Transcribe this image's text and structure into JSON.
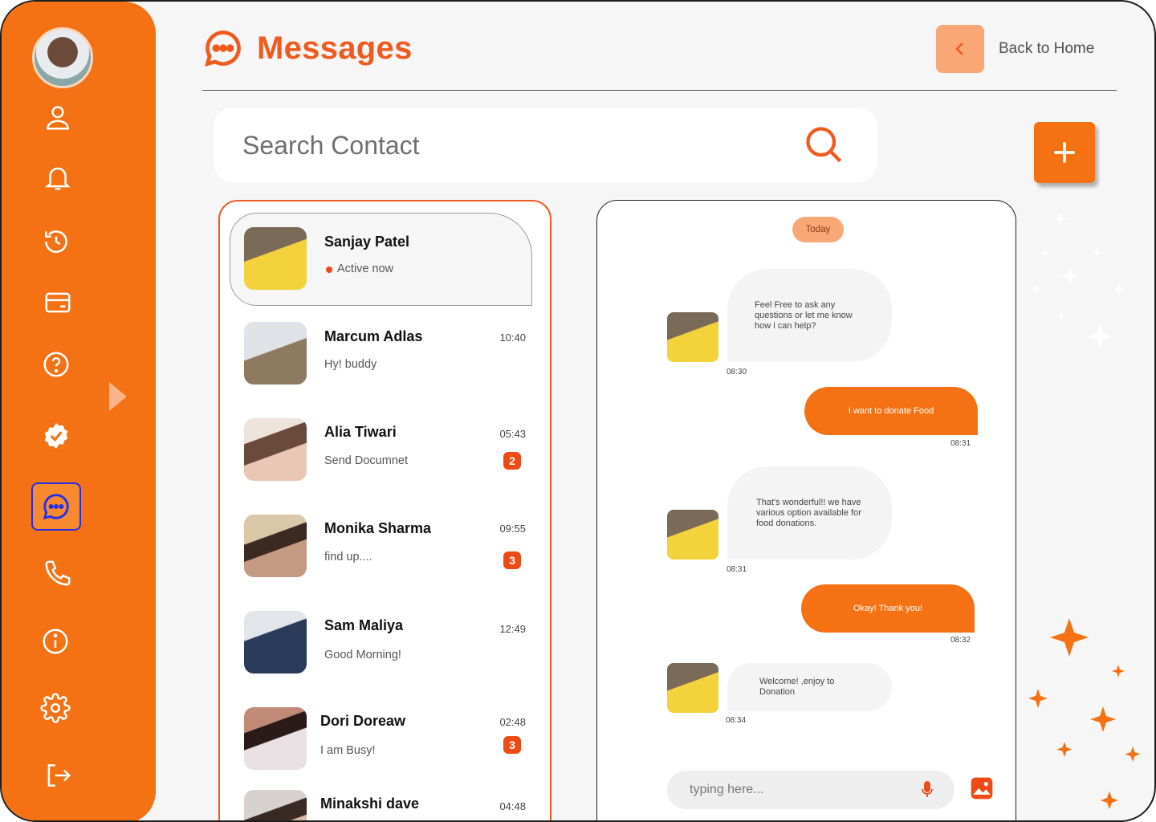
{
  "app": {
    "title": "Messages",
    "back_label": "Back to Home"
  },
  "colors": {
    "brand": "#f47214",
    "accent_red": "#ee4a16",
    "soft_orange": "#f9a774",
    "active_outline": "#2230e8"
  },
  "sidebar": {
    "items": [
      {
        "name": "profile",
        "icon": "user-icon"
      },
      {
        "name": "notifications",
        "icon": "bell-icon"
      },
      {
        "name": "history",
        "icon": "history-icon"
      },
      {
        "name": "wallet",
        "icon": "card-icon"
      },
      {
        "name": "help",
        "icon": "question-icon"
      },
      {
        "name": "verified",
        "icon": "verified-badge-icon"
      },
      {
        "name": "messages",
        "icon": "chat-icon",
        "active": true
      },
      {
        "name": "calls",
        "icon": "phone-icon"
      },
      {
        "name": "info",
        "icon": "info-icon"
      },
      {
        "name": "settings",
        "icon": "gear-icon"
      },
      {
        "name": "logout",
        "icon": "logout-icon"
      }
    ]
  },
  "search": {
    "placeholder": "Search Contact"
  },
  "contacts": [
    {
      "name": "Sanjay Patel",
      "status": "Active now",
      "selected": true,
      "avatar_color": "#e0b43a"
    },
    {
      "name": "Marcum Adlas",
      "last_message": "Hy! buddy",
      "time": "10:40",
      "avatar_color": "#c9ccd1"
    },
    {
      "name": "Alia Tiwari",
      "last_message": "Send Documnet",
      "time": "05:43",
      "unread": "2",
      "avatar_color": "#c79a86"
    },
    {
      "name": "Monika Sharma",
      "last_message": "find up....",
      "time": "09:55",
      "unread": "3",
      "avatar_color": "#a98a6a"
    },
    {
      "name": "Sam Maliya",
      "last_message": "Good Morning!",
      "time": "12:49",
      "avatar_color": "#2b3b5a"
    },
    {
      "name": "Dori Doreaw",
      "last_message": "I am Busy!",
      "time": "02:48",
      "unread": "3",
      "avatar_color": "#b8444e"
    },
    {
      "name": "Minakshi dave",
      "time": "04:48",
      "avatar_color": "#b9b2ae"
    }
  ],
  "chat": {
    "day_label": "Today",
    "messages": [
      {
        "direction": "in",
        "text": "Feel Free to ask any questions or let me know how i can help?",
        "time": "08:30"
      },
      {
        "direction": "out",
        "text": "I want to donate Food",
        "time": "08:31"
      },
      {
        "direction": "in",
        "text": "That's wonderful!! we have various option available for food donations.",
        "time": "08:31"
      },
      {
        "direction": "out",
        "text": "Okay! Thank you!",
        "time": "08:32"
      },
      {
        "direction": "in",
        "text": "Welcome! ,enjoy to Donation",
        "time": "08:34"
      }
    ],
    "composer_placeholder": "typing here..."
  }
}
